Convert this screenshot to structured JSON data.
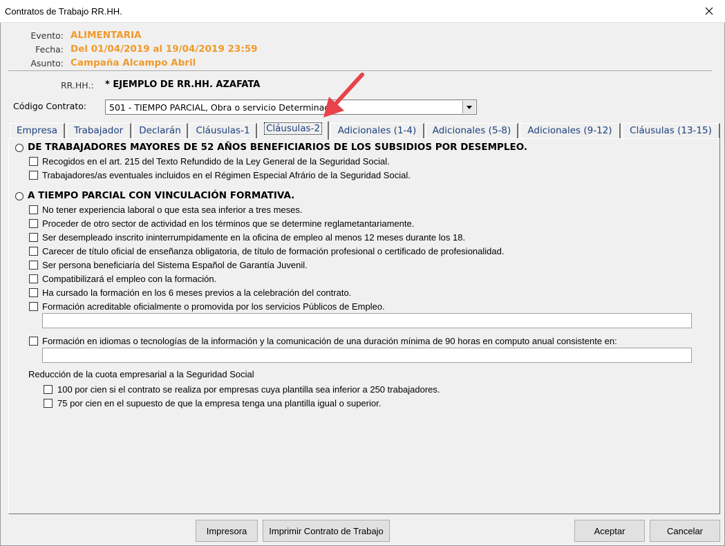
{
  "window": {
    "title": "Contratos de Trabajo RR.HH.",
    "close_glyph": "✕",
    "accent_color": "#f09a2c"
  },
  "header": {
    "evento_label": "Evento:",
    "evento_value": "ALIMENTARIA",
    "fecha_label": "Fecha:",
    "fecha_value": "Del 01/04/2019 al 19/04/2019 23:59",
    "asunto_label": "Asunto:",
    "asunto_value": "Campaña Alcampo Abril",
    "rrhh_label": "RR.HH.:",
    "rrhh_value": "* EJEMPLO DE RR.HH. AZAFATA",
    "codigo_label": "Código Contrato:",
    "codigo_value": "501 - TIEMPO PARCIAL, Obra o servicio Determinado"
  },
  "tabs": [
    {
      "label": "Empresa"
    },
    {
      "label": "Trabajador"
    },
    {
      "label": "Declarán"
    },
    {
      "label": "Cláusulas-1"
    },
    {
      "label": "Cláusulas-2",
      "active": true
    },
    {
      "label": "Adicionales (1-4)"
    },
    {
      "label": "Adicionales (5-8)"
    },
    {
      "label": "Adicionales (9-12)"
    },
    {
      "label": "Cláusulas (13-15)"
    }
  ],
  "section1": {
    "title": "DE TRABAJADORES MAYORES DE 52 AÑOS BENEFICIARIOS DE LOS SUBSIDIOS POR DESEMPLEO.",
    "options": [
      "Recogidos en el art. 215 del Texto Refundido de la Ley General de la Seguridad Social.",
      "Trabajadores/as eventuales incluidos en el Régimen Especial Afrário de la Seguridad Social."
    ]
  },
  "section2": {
    "title": "A TIEMPO PARCIAL CON VINCULACIÓN FORMATIVA.",
    "options": [
      "No tener experiencia laboral o que esta sea inferior a tres meses.",
      "Proceder de otro sector de actividad en los términos que se determine reglametantariamente.",
      "Ser desempleado inscrito ininterrumpidamente en la oficina de empleo al menos 12 meses durante los 18.",
      "Carecer de título oficial de enseñanza obligatoria, de título de formación profesional o certificado de profesionalidad.",
      "Ser persona beneficiaría del Sistema Español de Garantía Juvenil.",
      "Compatibilizará el empleo con la formación.",
      "Ha cursado la formación en los 6 meses previos a la celebración del contrato.",
      "Formación acreditable oficialmente o promovida por los servicios Públicos de Empleo."
    ],
    "formacion_acreditable_value": "",
    "idiomas_label": "Formación en idiomas o tecnologías de la información y la comunicación de una duración mínima de 90 horas en computo anual consistente en:",
    "idiomas_value": ""
  },
  "reduccion": {
    "title": "Reducción de la cuota empresarial a la Seguridad Social",
    "options": [
      "100 por cien si el contrato se realiza por empresas cuya plantilla sea inferior a 250 trabajadores.",
      "75 por cien en el supuesto de que la empresa tenga una plantilla igual o superior."
    ]
  },
  "buttons": {
    "impresora": "Impresora",
    "imprimir": "Imprimir Contrato de Trabajo",
    "aceptar": "Aceptar",
    "cancelar": "Cancelar"
  }
}
